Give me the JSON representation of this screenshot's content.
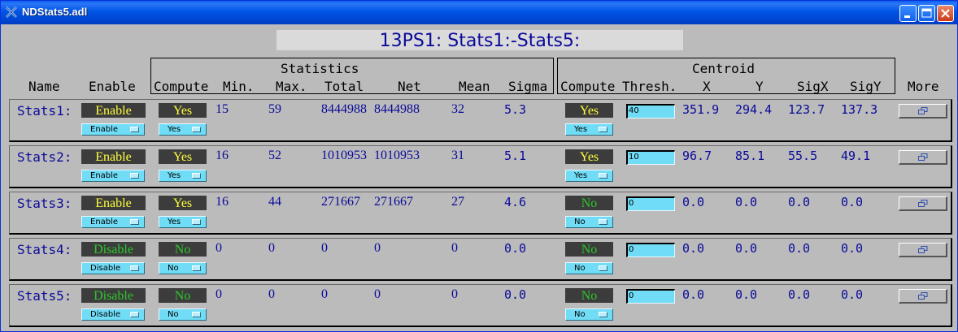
{
  "window": {
    "title": "NDStats5.adl"
  },
  "heading": "13PS1: Stats1:-Stats5:",
  "groups": {
    "statistics": "Statistics",
    "centroid": "Centroid"
  },
  "headers": {
    "name": "Name",
    "enable": "Enable",
    "compute": "Compute",
    "min": "Min.",
    "max": "Max.",
    "total": "Total",
    "net": "Net",
    "mean": "Mean",
    "sigma": "Sigma",
    "centroid_compute": "Compute",
    "thresh": "Thresh.",
    "x": "X",
    "y": "Y",
    "sigx": "SigX",
    "sigy": "SigY",
    "more": "More"
  },
  "rows": [
    {
      "name": "Stats1:",
      "enable_status": "Enable",
      "enable_menu": "Enable",
      "compute_status": "Yes",
      "compute_menu": "Yes",
      "min": "15",
      "max": "59",
      "total": "8444988",
      "net": "8444988",
      "mean": "32",
      "sigma": "5.3",
      "c_compute_status": "Yes",
      "c_compute_menu": "Yes",
      "thresh": "40",
      "x": "351.9",
      "y": "294.4",
      "sigx": "123.7",
      "sigy": "137.3"
    },
    {
      "name": "Stats2:",
      "enable_status": "Enable",
      "enable_menu": "Enable",
      "compute_status": "Yes",
      "compute_menu": "Yes",
      "min": "16",
      "max": "52",
      "total": "1010953",
      "net": "1010953",
      "mean": "31",
      "sigma": "5.1",
      "c_compute_status": "Yes",
      "c_compute_menu": "Yes",
      "thresh": "10",
      "x": "96.7",
      "y": "85.1",
      "sigx": "55.5",
      "sigy": "49.1"
    },
    {
      "name": "Stats3:",
      "enable_status": "Enable",
      "enable_menu": "Enable",
      "compute_status": "Yes",
      "compute_menu": "Yes",
      "min": "16",
      "max": "44",
      "total": "271667",
      "net": "271667",
      "mean": "27",
      "sigma": "4.6",
      "c_compute_status": "No",
      "c_compute_menu": "No",
      "thresh": "0",
      "x": "0.0",
      "y": "0.0",
      "sigx": "0.0",
      "sigy": "0.0"
    },
    {
      "name": "Stats4:",
      "enable_status": "Disable",
      "enable_menu": "Disable",
      "compute_status": "No",
      "compute_menu": "No",
      "min": "0",
      "max": "0",
      "total": "0",
      "net": "0",
      "mean": "0",
      "sigma": "0.0",
      "c_compute_status": "No",
      "c_compute_menu": "No",
      "thresh": "0",
      "x": "0.0",
      "y": "0.0",
      "sigx": "0.0",
      "sigy": "0.0"
    },
    {
      "name": "Stats5:",
      "enable_status": "Disable",
      "enable_menu": "Disable",
      "compute_status": "No",
      "compute_menu": "No",
      "min": "0",
      "max": "0",
      "total": "0",
      "net": "0",
      "mean": "0",
      "sigma": "0.0",
      "c_compute_status": "No",
      "c_compute_menu": "No",
      "thresh": "0",
      "x": "0.0",
      "y": "0.0",
      "sigx": "0.0",
      "sigy": "0.0"
    }
  ],
  "icons": {
    "app": "medm-x-icon",
    "more": "related-display-icon"
  },
  "colors": {
    "status_on": "#fffe3c",
    "status_off": "#2cc82c",
    "menu_bg": "#70dcf6",
    "value_text": "#0a0a9a",
    "indicator_bg": "#3c3c3c"
  }
}
